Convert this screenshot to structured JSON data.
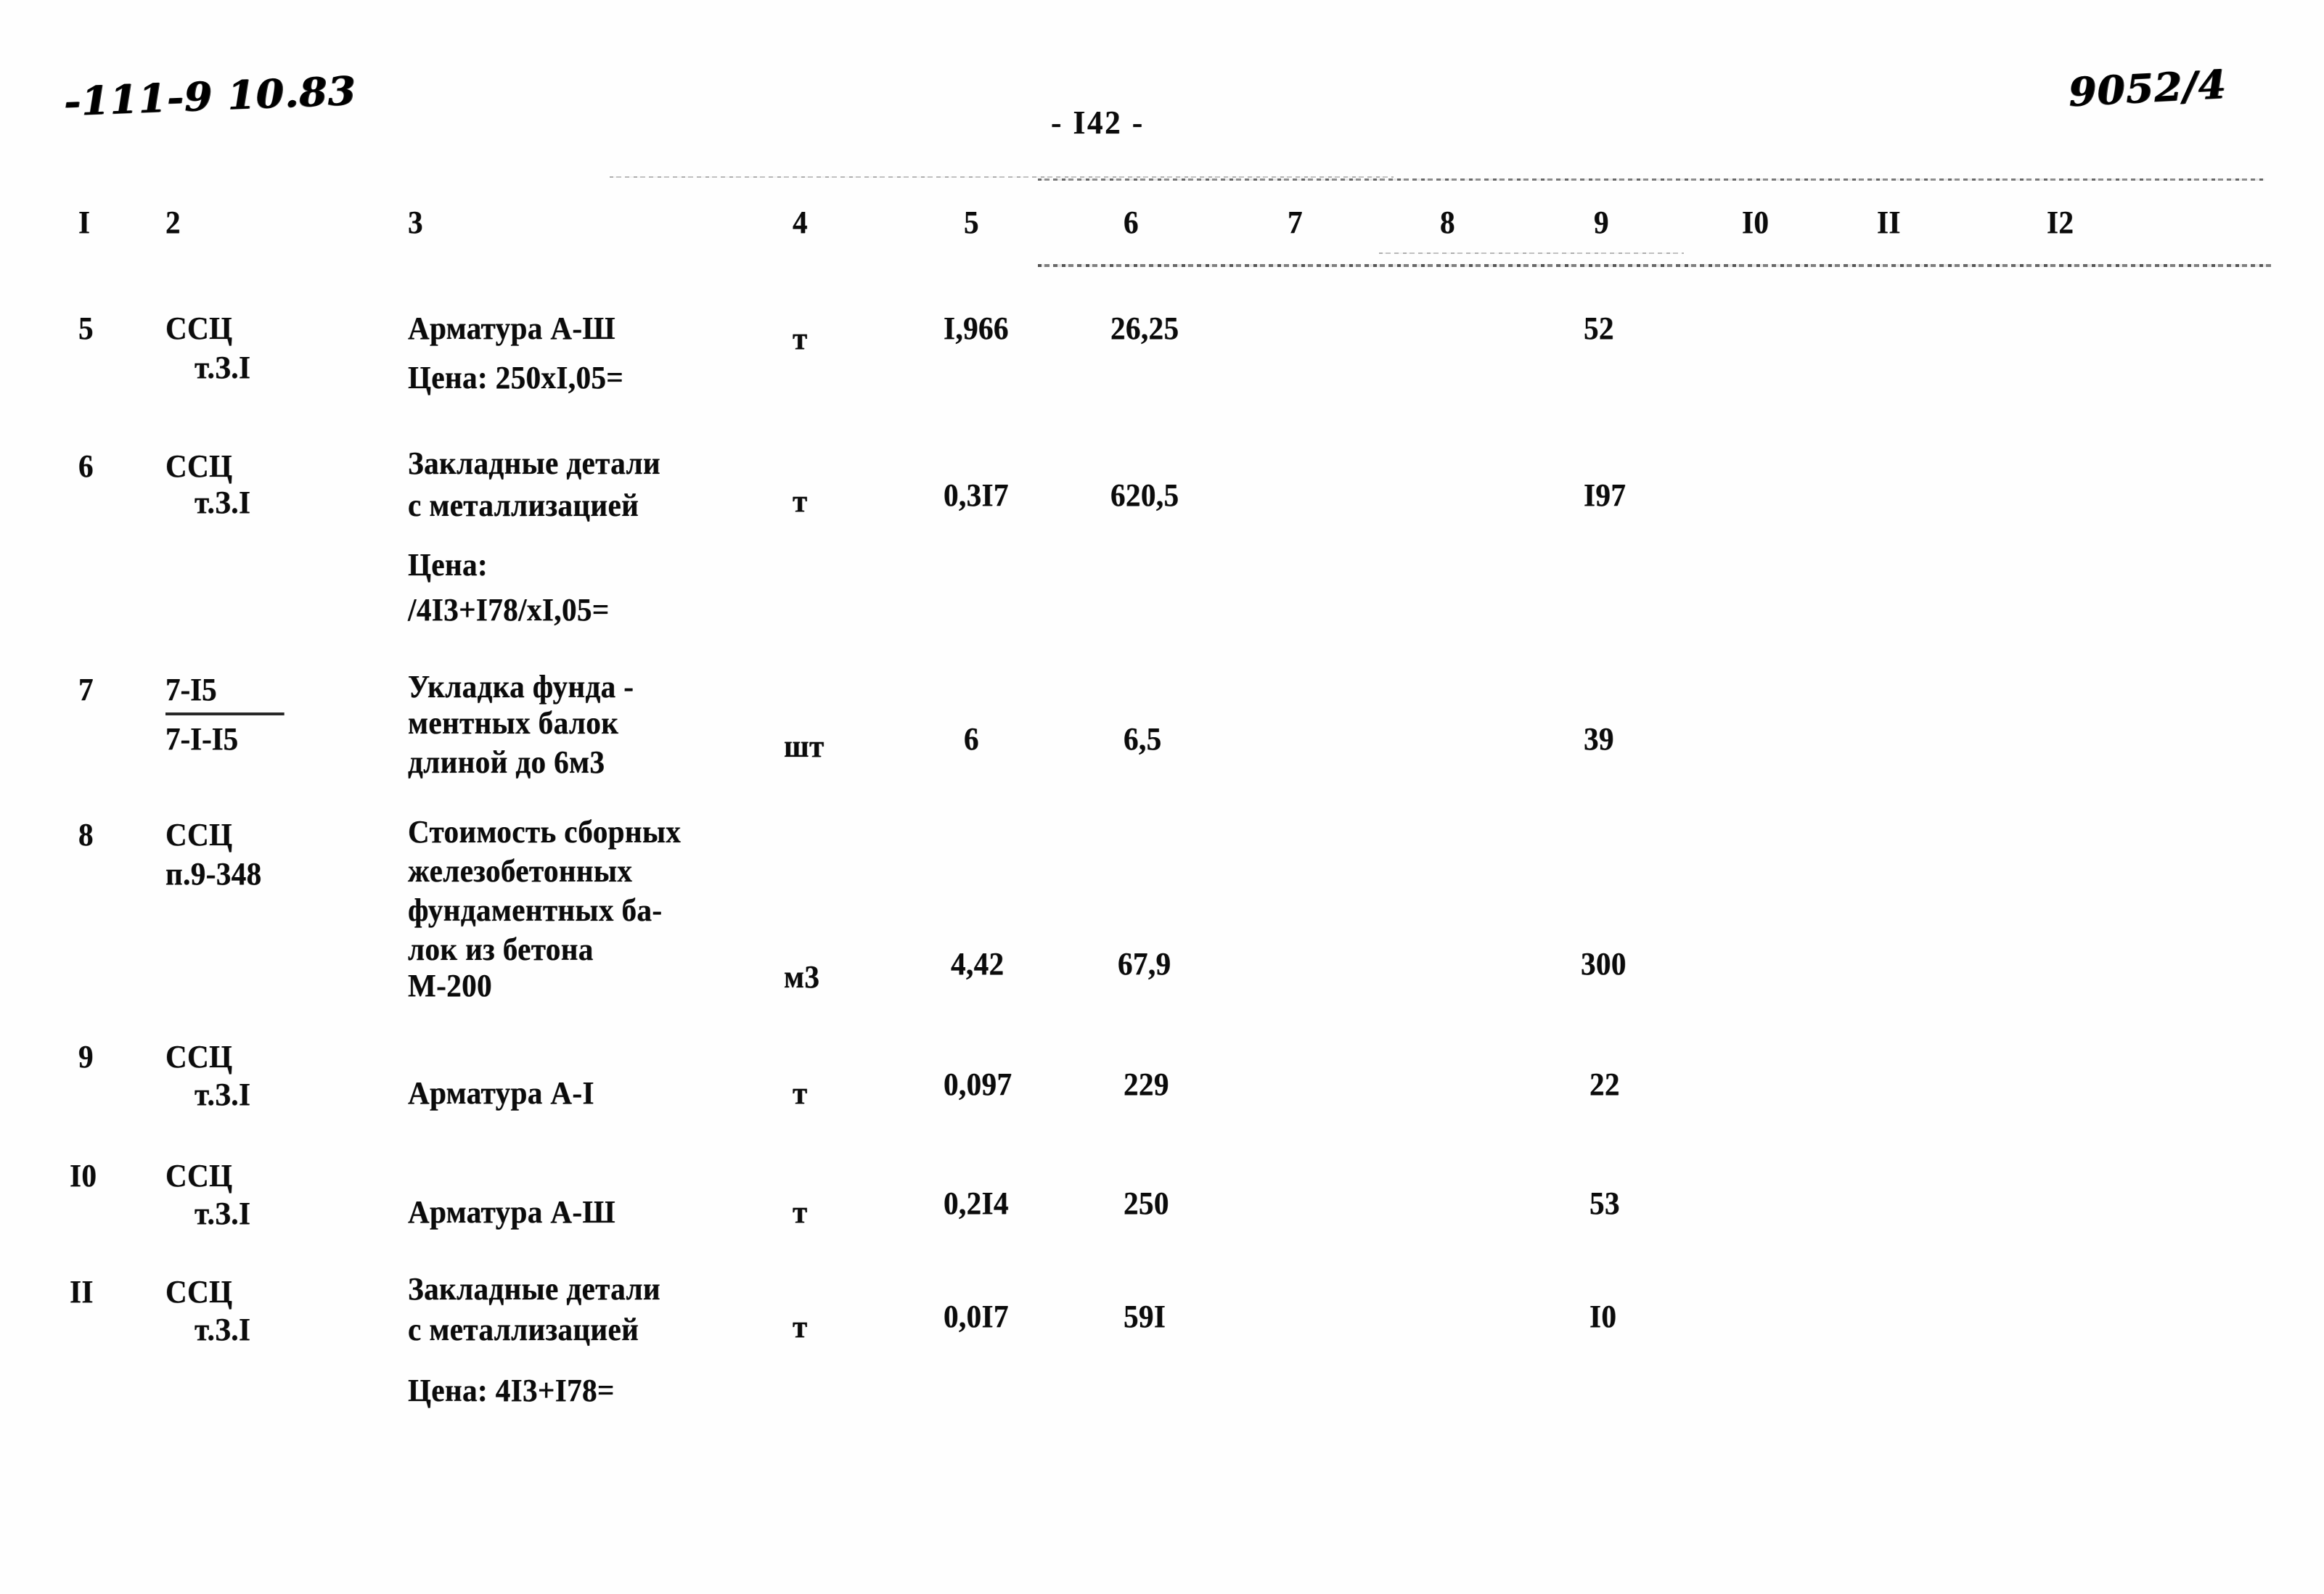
{
  "document": {
    "page_label": "- I42 -",
    "annotation_top_left": "-111-9 10.83",
    "annotation_top_right": "9052/4"
  },
  "table": {
    "column_headers": [
      "I",
      "2",
      "3",
      "4",
      "5",
      "6",
      "7",
      "8",
      "9",
      "I0",
      "II",
      "I2"
    ],
    "rows": [
      {
        "num": "5",
        "code_line1": "ССЦ",
        "code_line2": "т.З.I",
        "desc_lines": [
          "Арматура А-Ш",
          "Цена: 250хI,05="
        ],
        "unit": "т",
        "col5": "I,966",
        "col6": "26,25",
        "col7": "",
        "col8": "",
        "col9": "52",
        "col10": "",
        "col11": "",
        "col12": ""
      },
      {
        "num": "6",
        "code_line1": "ССЦ",
        "code_line2": "т.З.I",
        "desc_lines": [
          "Закладные детали",
          "с металлизацией",
          "Цена:",
          "/4I3+I78/хI,05="
        ],
        "unit": "т",
        "col5": "0,3I7",
        "col6": "620,5",
        "col7": "",
        "col8": "",
        "col9": "I97",
        "col10": "",
        "col11": "",
        "col12": ""
      },
      {
        "num": "7",
        "code_numerator": "7-I5",
        "code_denominator": "7-I-I5",
        "desc_lines": [
          "Укладка фунда -",
          "ментных балок",
          "длиной до 6м3"
        ],
        "unit": "шт",
        "col5": "6",
        "col6": "6,5",
        "col7": "",
        "col8": "",
        "col9": "39",
        "col10": "",
        "col11": "",
        "col12": ""
      },
      {
        "num": "8",
        "code_line1": "ССЦ",
        "code_line2": "п.9-348",
        "desc_lines": [
          "Стоимость сборных",
          "железобетонных",
          "фундаментных ба-",
          "лок из бетона",
          "М-200"
        ],
        "unit": "м3",
        "col5": "4,42",
        "col6": "67,9",
        "col7": "",
        "col8": "",
        "col9": "300",
        "col10": "",
        "col11": "",
        "col12": ""
      },
      {
        "num": "9",
        "code_line1": "ССЦ",
        "code_line2": "т.З.I",
        "desc_lines": [
          "Арматура А-I"
        ],
        "unit": "т",
        "col5": "0,097",
        "col6": "229",
        "col7": "",
        "col8": "",
        "col9": "22",
        "col10": "",
        "col11": "",
        "col12": ""
      },
      {
        "num": "I0",
        "code_line1": "ССЦ",
        "code_line2": "т.З.I",
        "desc_lines": [
          "Арматура А-Ш"
        ],
        "unit": "т",
        "col5": "0,2I4",
        "col6": "250",
        "col7": "",
        "col8": "",
        "col9": "53",
        "col10": "",
        "col11": "",
        "col12": ""
      },
      {
        "num": "II",
        "code_line1": "ССЦ",
        "code_line2": "т.З.I",
        "desc_lines": [
          "Закладные детали",
          "с металлизацией",
          "Цена: 4I3+I78="
        ],
        "unit": "т",
        "col5": "0,0I7",
        "col6": "59I",
        "col7": "",
        "col8": "",
        "col9": "I0",
        "col10": "",
        "col11": "",
        "col12": ""
      }
    ]
  }
}
